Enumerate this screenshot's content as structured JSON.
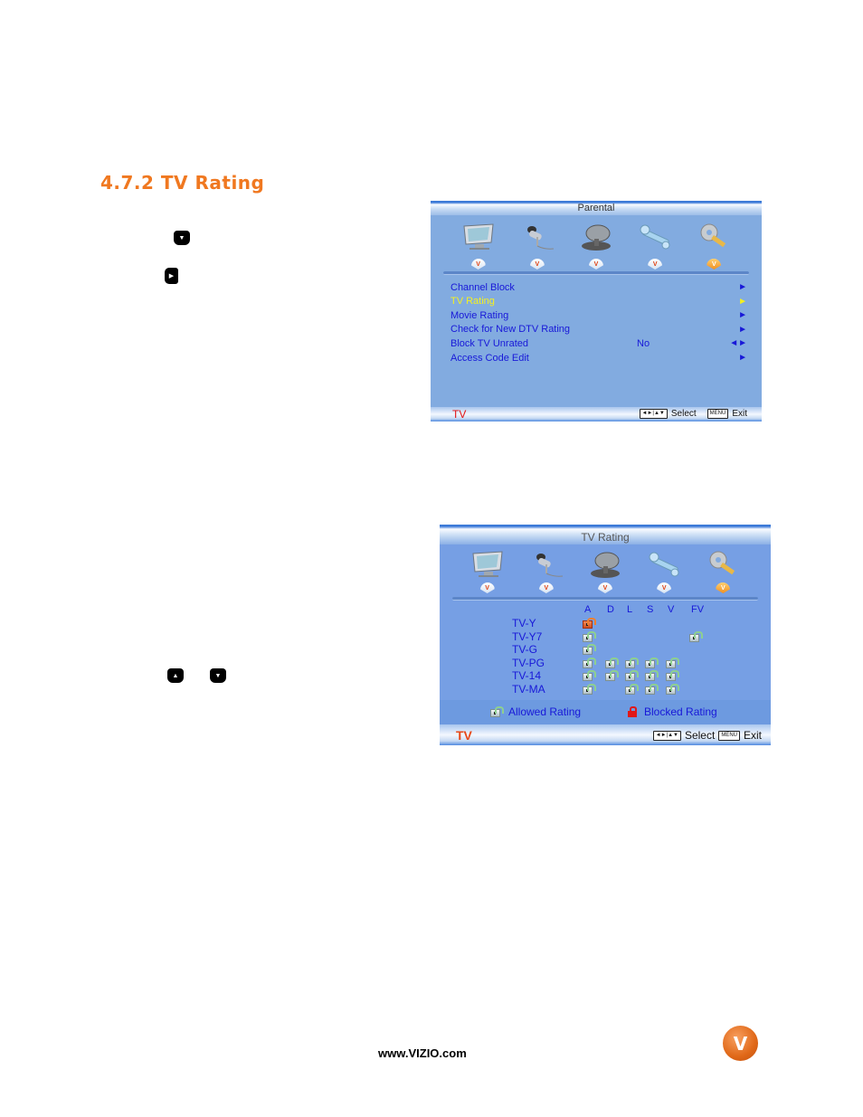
{
  "section": {
    "title": "4.7.2 TV Rating"
  },
  "instructions": {
    "step_buttons": [
      {
        "icon": "down-arrow-button-icon"
      },
      {
        "icon": "right-arrow-button-icon"
      },
      {
        "icon": "up-arrow-button-icon"
      },
      {
        "icon": "down-arrow-button-icon"
      }
    ]
  },
  "parental_menu": {
    "title": "Parental",
    "tab_icons": [
      "picture-icon",
      "audio-icon",
      "tv-antenna-icon",
      "setup-wrench-icon",
      "parental-key-icon"
    ],
    "active_tab_index": 4,
    "items": [
      {
        "label": "Channel Block",
        "value": "",
        "control": "►"
      },
      {
        "label": "TV Rating",
        "value": "",
        "control": "►",
        "selected": true
      },
      {
        "label": "Movie Rating",
        "value": "",
        "control": "►"
      },
      {
        "label": "Check for New DTV Rating",
        "value": "",
        "control": "►"
      },
      {
        "label": "Block TV Unrated",
        "value": "No",
        "control": "◄►"
      },
      {
        "label": "Access Code Edit",
        "value": "",
        "control": "►"
      }
    ],
    "footer": {
      "source": "TV",
      "nav_key": "◄►|▲▼",
      "select_label": "Select",
      "menu_key": "MENU",
      "exit_label": "Exit"
    },
    "colors": {
      "background": "#82abe0",
      "item_text": "#1818d8",
      "selected_text": "#f4f020",
      "source_text": "#e21212"
    }
  },
  "tv_rating_menu": {
    "title": "TV  Rating",
    "tab_icons": [
      "picture-icon",
      "audio-icon",
      "tv-antenna-icon",
      "setup-wrench-icon",
      "parental-key-icon"
    ],
    "active_tab_index": 4,
    "columns": [
      "A",
      "D",
      "L",
      "S",
      "V",
      "FV"
    ],
    "rows": [
      {
        "label": "TV-Y",
        "cells": [
          "blocked",
          null,
          null,
          null,
          null,
          null
        ]
      },
      {
        "label": "TV-Y7",
        "cells": [
          "allowed",
          null,
          null,
          null,
          null,
          "allowed"
        ]
      },
      {
        "label": "TV-G",
        "cells": [
          "allowed",
          null,
          null,
          null,
          null,
          null
        ]
      },
      {
        "label": "TV-PG",
        "cells": [
          "allowed",
          "allowed",
          "allowed",
          "allowed",
          "allowed",
          null
        ]
      },
      {
        "label": "TV-14",
        "cells": [
          "allowed",
          "allowed",
          "allowed",
          "allowed",
          "allowed",
          null
        ]
      },
      {
        "label": "TV-MA",
        "cells": [
          "allowed",
          null,
          "allowed",
          "allowed",
          "allowed",
          null
        ]
      }
    ],
    "legend": {
      "allowed": "Allowed  Rating",
      "blocked": "Blocked  Rating"
    },
    "footer": {
      "source": "TV",
      "nav_key": "◄►|▲▼",
      "select_label": "Select",
      "menu_key": "MENU",
      "exit_label": "Exit"
    }
  },
  "page_footer": {
    "url": "www.VIZIO.com",
    "logo_letter": "V"
  }
}
